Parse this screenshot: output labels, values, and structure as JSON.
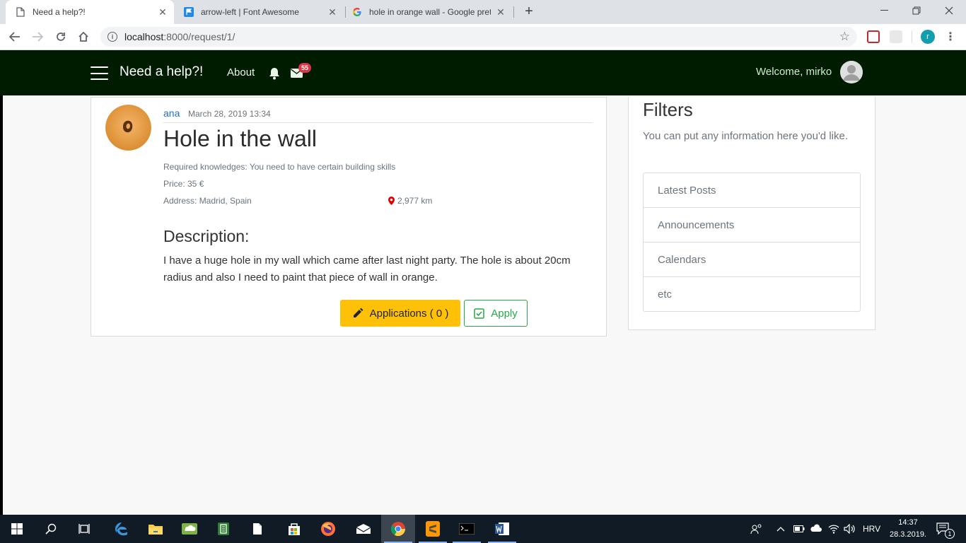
{
  "browser": {
    "tabs": [
      {
        "title": "Need a help?!",
        "active": true
      },
      {
        "title": "arrow-left | Font Awesome",
        "active": false
      },
      {
        "title": "hole in orange wall - Google pret",
        "active": false
      }
    ],
    "url_host": "localhost",
    "url_path": ":8000/request/1/",
    "profile_initial": "r"
  },
  "navbar": {
    "brand": "Need a help?!",
    "about": "About",
    "mail_badge": "55",
    "welcome": "Welcome, mirko"
  },
  "post": {
    "author": "ana",
    "date": "March 28, 2019 13:34",
    "title": "Hole in the wall",
    "required": "Required knowledges: You need to have certain building skills",
    "price": "Price: 35 €",
    "address": "Address: Madrid, Spain",
    "distance": "2,977 km",
    "description_title": "Description:",
    "description": "I have a huge hole in my wall which came after last night party. The hole is about 20cm radius and also I need to paint that piece of wall in orange.",
    "applications_label": "Applications ( 0 )",
    "apply_label": "Apply"
  },
  "sidebar": {
    "title": "Filters",
    "text": "You can put any information here you'd like.",
    "items": [
      "Latest Posts",
      "Announcements",
      "Calendars",
      "etc"
    ]
  },
  "taskbar": {
    "language": "HRV",
    "time": "14:37",
    "date": "28.3.2019.",
    "notification_count": "1"
  },
  "colors": {
    "navbar_bg": "#001c00",
    "author_link": "#1f6fc5",
    "warning": "#ffc107",
    "success": "#28a745",
    "badge": "#dc3545"
  }
}
